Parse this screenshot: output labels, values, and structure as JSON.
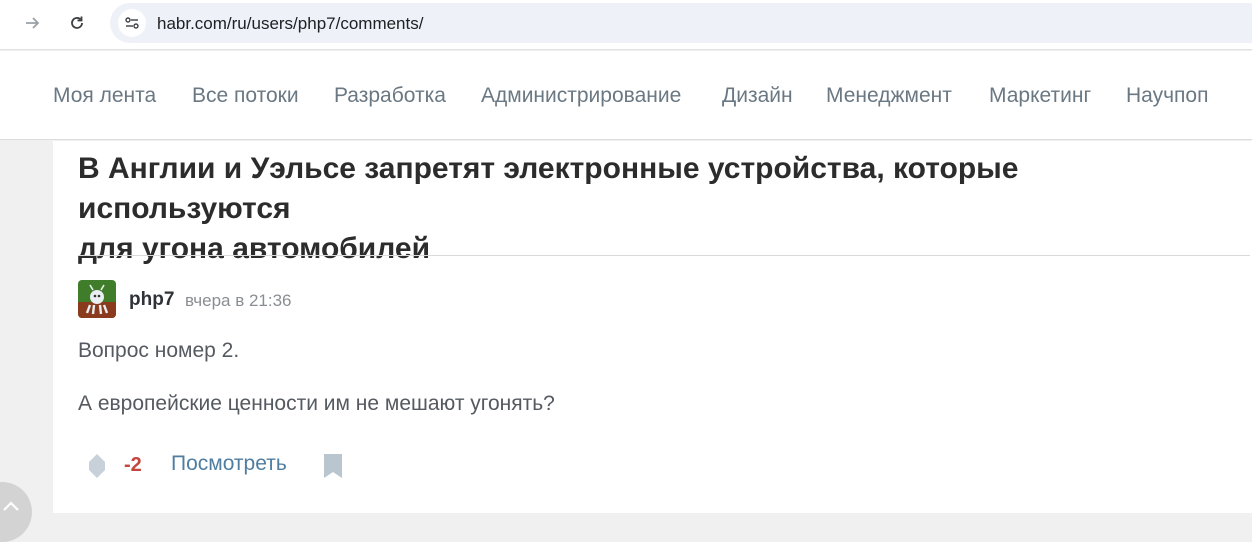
{
  "browser": {
    "url": "habr.com/ru/users/php7/comments/",
    "icons": [
      "forward-icon",
      "reload-icon",
      "site-info-icon"
    ]
  },
  "nav": {
    "items": [
      "Моя лента",
      "Все потоки",
      "Разработка",
      "Администрирование",
      "Дизайн",
      "Менеджмент",
      "Маркетинг",
      "Научпоп"
    ]
  },
  "post": {
    "title_line1": "В Англии и Уэльсе запретят электронные устройства, которые используются",
    "title_line2": "для угона автомобилей"
  },
  "comment": {
    "author": "php7",
    "time": "вчера в 21:36",
    "paragraphs": [
      "Вопрос номер 2.",
      "А европейские ценности им не мешают угонять?"
    ],
    "score": "-2",
    "view_label": "Посмотреть"
  },
  "colors": {
    "nav_text": "#6a7883",
    "link": "#4f7ea1",
    "negative_score": "#c5463e",
    "title": "#2c2c2c"
  }
}
